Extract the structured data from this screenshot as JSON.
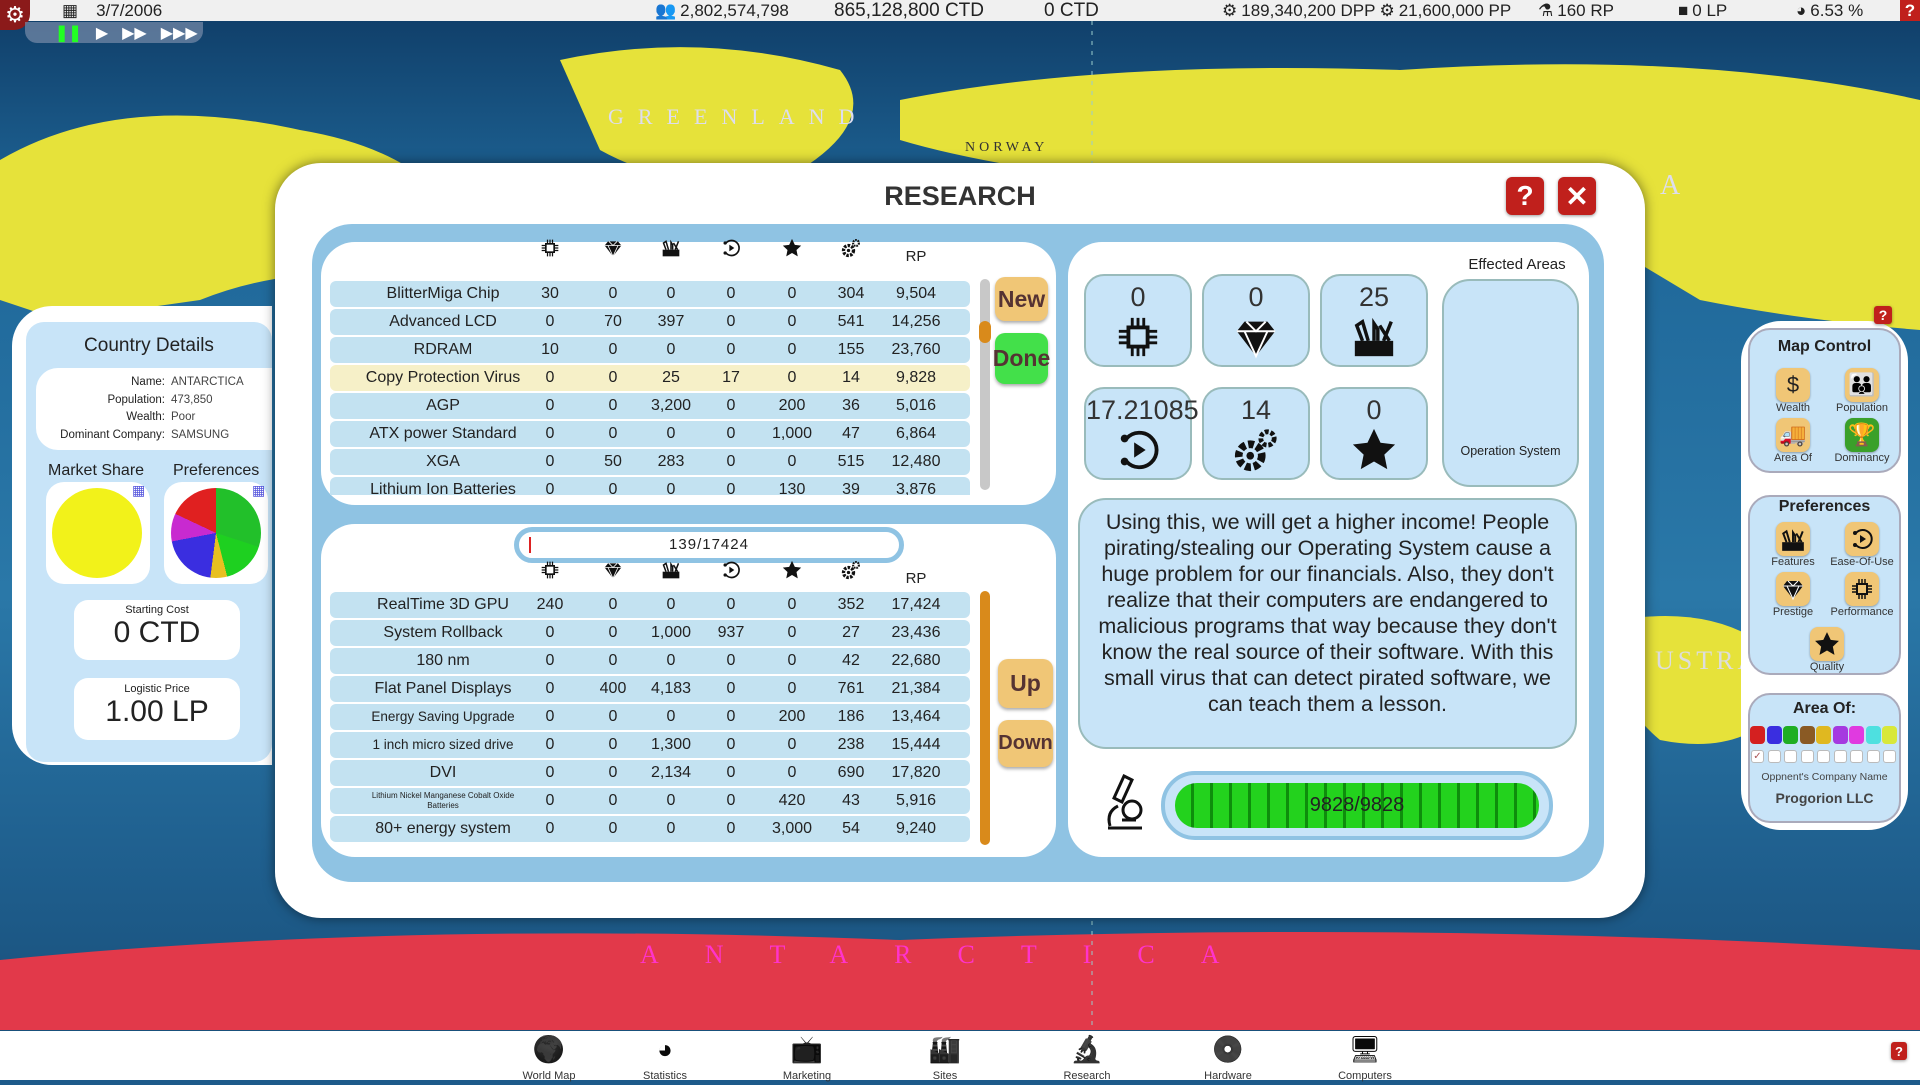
{
  "topbar": {
    "date": "3/7/2006",
    "population": "2,802,574,798",
    "money": "865,128,800 CTD",
    "income": "0 CTD",
    "dpp": "189,340,200 DPP",
    "pp": "21,600,000 PP",
    "rp": "160 RP",
    "lp": "0 LP",
    "share": "6.53 %",
    "help": "?"
  },
  "map_labels": {
    "greenland": "GREENLAND",
    "norway": "NORWAY",
    "antarctica": "ANTARCTICA",
    "australia": "USTRA",
    "asia": "A"
  },
  "dialog": {
    "title": "RESEARCH",
    "help": "?",
    "close": "✕",
    "columns": [
      {
        "icon": "performance-chip-icon"
      },
      {
        "icon": "prestige-diamond-icon"
      },
      {
        "icon": "features-toolbox-icon"
      },
      {
        "icon": "ease-of-use-icon"
      },
      {
        "icon": "quality-star-icon"
      },
      {
        "icon": "development-gears-icon"
      },
      {
        "label": "RP"
      }
    ],
    "available": [
      {
        "name": "BlitterMiga Chip",
        "values": [
          "30",
          "0",
          "0",
          "0",
          "0",
          "304",
          "9,504"
        ]
      },
      {
        "name": "Advanced LCD",
        "values": [
          "0",
          "70",
          "397",
          "0",
          "0",
          "541",
          "14,256"
        ]
      },
      {
        "name": "RDRAM",
        "values": [
          "10",
          "0",
          "0",
          "0",
          "0",
          "155",
          "23,760"
        ]
      },
      {
        "name": "Copy Protection Virus",
        "values": [
          "0",
          "0",
          "25",
          "17",
          "0",
          "14",
          "9,828"
        ],
        "selected": true
      },
      {
        "name": "AGP",
        "values": [
          "0",
          "0",
          "3,200",
          "0",
          "200",
          "36",
          "5,016"
        ]
      },
      {
        "name": "ATX power Standard",
        "values": [
          "0",
          "0",
          "0",
          "0",
          "1,000",
          "47",
          "6,864"
        ]
      },
      {
        "name": "XGA",
        "values": [
          "0",
          "50",
          "283",
          "0",
          "0",
          "515",
          "12,480"
        ]
      },
      {
        "name": "Lithium Ion Batteries",
        "values": [
          "0",
          "0",
          "0",
          "0",
          "130",
          "39",
          "3,876"
        ]
      }
    ],
    "new_label": "New",
    "done_label": "Done",
    "queue_progress": "139/17424",
    "queue": [
      {
        "name": "RealTime 3D GPU",
        "values": [
          "240",
          "0",
          "0",
          "0",
          "0",
          "352",
          "17,424"
        ]
      },
      {
        "name": "System Rollback",
        "values": [
          "0",
          "0",
          "1,000",
          "937",
          "0",
          "27",
          "23,436"
        ]
      },
      {
        "name": "180 nm",
        "values": [
          "0",
          "0",
          "0",
          "0",
          "0",
          "42",
          "22,680"
        ]
      },
      {
        "name": "Flat Panel Displays",
        "values": [
          "0",
          "400",
          "4,183",
          "0",
          "0",
          "761",
          "21,384"
        ]
      },
      {
        "name": "Energy Saving Upgrade",
        "values": [
          "0",
          "0",
          "0",
          "0",
          "200",
          "186",
          "13,464"
        ],
        "small": true
      },
      {
        "name": "1 inch micro sized drive",
        "values": [
          "0",
          "0",
          "1,300",
          "0",
          "0",
          "238",
          "15,444"
        ],
        "small": true
      },
      {
        "name": "DVI",
        "values": [
          "0",
          "0",
          "2,134",
          "0",
          "0",
          "690",
          "17,820"
        ]
      },
      {
        "name": "Lithium Nickel Manganese Cobalt Oxide Batteries",
        "values": [
          "0",
          "0",
          "0",
          "0",
          "420",
          "43",
          "5,916"
        ],
        "tiny": true
      },
      {
        "name": "80+ energy system",
        "values": [
          "0",
          "0",
          "0",
          "0",
          "3,000",
          "54",
          "9,240"
        ]
      }
    ],
    "up_label": "Up",
    "down_label": "Down",
    "detail": {
      "tiles": [
        {
          "value": "0",
          "icon": "performance-chip-icon"
        },
        {
          "value": "0",
          "icon": "prestige-diamond-icon"
        },
        {
          "value": "25",
          "icon": "features-toolbox-icon"
        },
        {
          "value": "17.21085",
          "icon": "ease-of-use-icon"
        },
        {
          "value": "14",
          "icon": "development-gears-icon"
        },
        {
          "value": "0",
          "icon": "quality-star-icon"
        }
      ],
      "effected_areas_label": "Effected Areas",
      "effected_area": "Operation System",
      "description": "Using this, we will get a higher income! People pirating/stealing our Operating System cause a huge problem for our financials. Also, they don't realize that their computers are endangered to malicious programs that way because they don't know the real source of their software. With this small virus that can detect pirated software, we can teach them a lesson.",
      "progress_text": "9828/9828",
      "progress_percent": 100
    }
  },
  "country": {
    "title": "Country Details",
    "fields": [
      {
        "label": "Name:",
        "value": "ANTARCTICA"
      },
      {
        "label": "Population:",
        "value": "473,850"
      },
      {
        "label": "Wealth:",
        "value": "Poor"
      },
      {
        "label": "Dominant Company:",
        "value": "SAMSUNG"
      }
    ],
    "market_share_label": "Market Share",
    "preferences_label": "Preferences",
    "starting_cost_label": "Starting Cost",
    "starting_cost": "0 CTD",
    "logistic_price_label": "Logistic Price",
    "logistic_price": "1.00 LP"
  },
  "map_control": {
    "help": "?",
    "title": "Map Control",
    "items": [
      {
        "label": "Wealth",
        "icon": "dollar-icon"
      },
      {
        "label": "Population",
        "icon": "people-icon"
      },
      {
        "label": "Area Of",
        "icon": "truck-icon"
      },
      {
        "label": "Dominancy",
        "icon": "podium-icon",
        "active": true
      }
    ],
    "preferences_title": "Preferences",
    "preferences": [
      {
        "label": "Features"
      },
      {
        "label": "Ease-Of-Use"
      },
      {
        "label": "Prestige"
      },
      {
        "label": "Performance"
      },
      {
        "label": "Quality"
      }
    ],
    "area_title": "Area Of:",
    "area_colors": [
      "#d42020",
      "#3a2ee0",
      "#1fae22",
      "#8a5a24",
      "#e0b820",
      "#a53ae0",
      "#e03ae0",
      "#4ee0e0",
      "#d8e83a"
    ],
    "area_checked": [
      true,
      false,
      false,
      false,
      false,
      false,
      false,
      false,
      false
    ],
    "opponent_label": "Oppnent's Company Name",
    "opponent": "Progorion LLC"
  },
  "nav": {
    "items": [
      {
        "label": "World Map",
        "icon": "world-map-icon"
      },
      {
        "label": "Statistics",
        "icon": "pie-chart-icon"
      },
      {
        "label": "Marketing",
        "icon": "tv-icon"
      },
      {
        "label": "Sites",
        "icon": "factory-icon"
      },
      {
        "label": "Research",
        "icon": "microscope-icon"
      },
      {
        "label": "Hardware",
        "icon": "disc-icon"
      },
      {
        "label": "Computers",
        "icon": "computer-icon"
      }
    ],
    "help": "?"
  }
}
